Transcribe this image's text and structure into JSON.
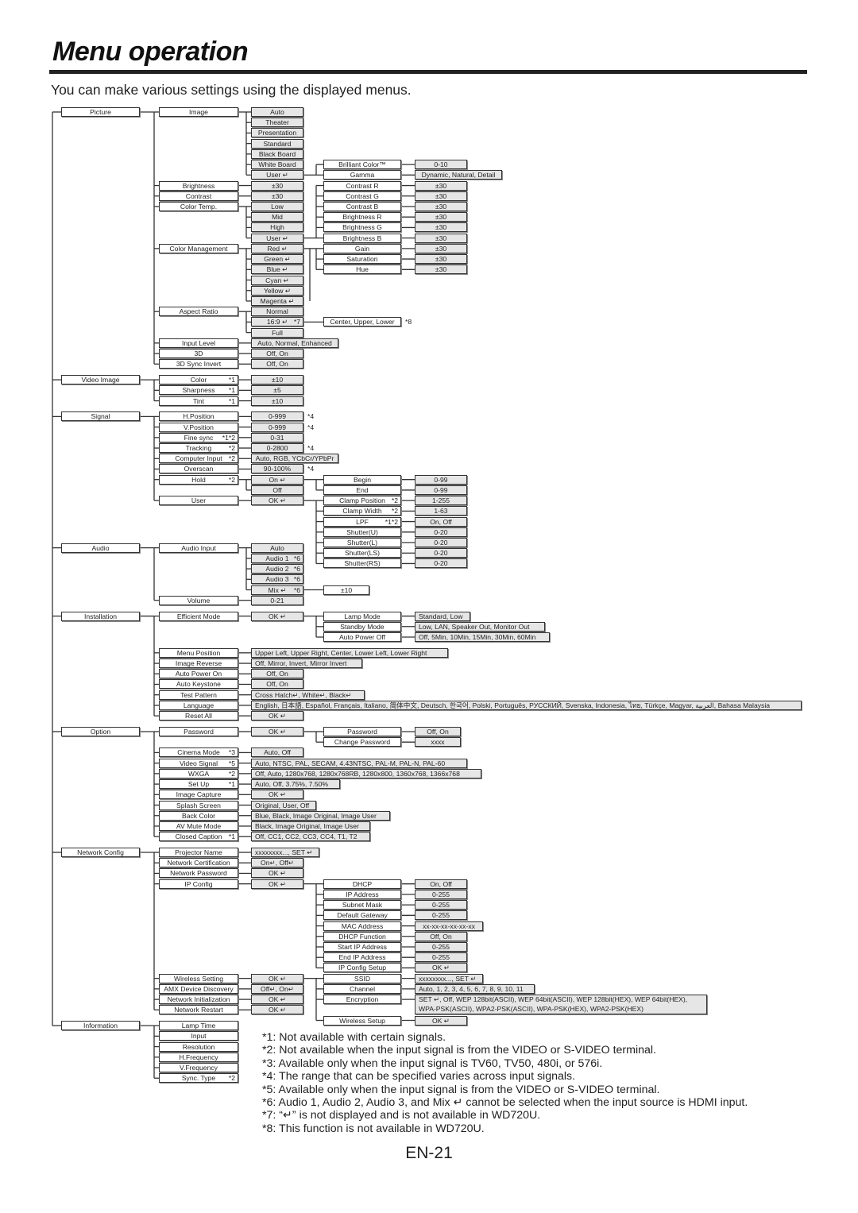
{
  "header": {
    "title": "Menu operation",
    "subtitle": "You can make various settings using the displayed menus."
  },
  "menu": {
    "top": [
      "Picture",
      "Video Image",
      "Signal",
      "Audio",
      "Installation",
      "Option",
      "Network Config",
      "Information"
    ],
    "picture": {
      "items": [
        "Image",
        "Brightness",
        "Contrast",
        "Color Temp.",
        "Color Management",
        "Aspect Ratio",
        "Input Level",
        "3D",
        "3D Sync Invert"
      ],
      "image_modes": [
        "Auto",
        "Theater",
        "Presentation",
        "Standard",
        "Black Board",
        "White Board",
        "User ↵"
      ],
      "brightness_value": "±30",
      "contrast_value": "±30",
      "color_temp": [
        "Low",
        "Mid",
        "High",
        "User ↵"
      ],
      "color_mgmt": [
        "Red ↵",
        "Green ↵",
        "Blue ↵",
        "Cyan ↵",
        "Yellow ↵",
        "Magenta ↵"
      ],
      "aspect": [
        "Normal",
        "16:9 ↵",
        "Full"
      ],
      "aspect_note": "*7",
      "input_level_value": "Auto, Normal, Enhanced",
      "d3_value": "Off, On",
      "d3_sync_value": "Off, On",
      "user_image": [
        "Brilliant Color™",
        "Gamma"
      ],
      "user_image_values": [
        "0-10",
        "Dynamic, Natural, Detail"
      ],
      "user_temp": [
        "Contrast R",
        "Contrast G",
        "Contrast B",
        "Brightness R",
        "Brightness G",
        "Brightness B"
      ],
      "user_temp_values": [
        "±30",
        "±30",
        "±30",
        "±30",
        "±30",
        "±30"
      ],
      "cm_items": [
        "Gain",
        "Saturation",
        "Hue"
      ],
      "cm_values": [
        "±30",
        "±30",
        "±30"
      ],
      "aspect_sub": "Center, Upper, Lower",
      "aspect_sub_note": "*8"
    },
    "video_image": {
      "items": [
        "Color",
        "Sharpness",
        "Tint"
      ],
      "item_notes": [
        "*1",
        "*1",
        "*1"
      ],
      "values": [
        "±10",
        "±5",
        "±10"
      ]
    },
    "signal": {
      "items": [
        "H.Position",
        "V.Position",
        "Fine sync",
        "Tracking",
        "Computer Input",
        "Overscan",
        "Hold",
        "User"
      ],
      "item_notes": [
        "",
        "",
        "*1*2",
        "*2",
        "*2",
        "",
        "*2",
        ""
      ],
      "values": [
        "0-999",
        "0-999",
        "0-31",
        "0-2800",
        "Auto, RGB, YCbCr/YPbPr",
        "90-100%"
      ],
      "value_notes": [
        "*4",
        "*4",
        "",
        "*4",
        "",
        "*4"
      ],
      "hold_values": [
        "On ↵",
        "Off"
      ],
      "user_value": "OK ↵",
      "hold_sub": [
        "Begin",
        "End"
      ],
      "hold_sub_values": [
        "0-99",
        "0-99"
      ],
      "user_sub": [
        "Clamp Position",
        "Clamp Width",
        "LPF",
        "Shutter(U)",
        "Shutter(L)",
        "Shutter(LS)",
        "Shutter(RS)"
      ],
      "user_sub_notes": [
        "*2",
        "*2",
        "*1*2",
        "",
        "",
        "",
        ""
      ],
      "user_sub_values": [
        "1-255",
        "1-63",
        "On, Off",
        "0-20",
        "0-20",
        "0-20",
        "0-20"
      ]
    },
    "audio": {
      "items": [
        "Audio Input",
        "Volume"
      ],
      "input_values": [
        "Auto",
        "Audio 1",
        "Audio 2",
        "Audio 3",
        "Mix ↵"
      ],
      "input_notes": [
        "",
        "*6",
        "*6",
        "*6",
        "*6"
      ],
      "volume_value": "0-21",
      "mix_value": "±10"
    },
    "installation": {
      "items": [
        "Efficient Mode",
        "Menu Position",
        "Image Reverse",
        "Auto Power On",
        "Auto Keystone",
        "Test Pattern",
        "Language",
        "Reset All"
      ],
      "values": [
        "OK ↵",
        "Upper Left, Upper Right, Center, Lower Left, Lower Right",
        "Off, Mirror, Invert, Mirror Invert",
        "Off, On",
        "Off, On",
        "Cross Hatch↵, White↵, Black↵",
        "English, 日本語, Español, Français, Italiano, 简体中文, Deutsch, 한국어, Polski, Português, РУССКИЙ, Svenska, Indonesia, ไทย, Türkçe, Magyar, العربية, Bahasa Malaysia",
        "OK ↵"
      ],
      "efficient_sub": [
        "Lamp Mode",
        "Standby Mode",
        "Auto Power Off"
      ],
      "efficient_sub_values": [
        "Standard, Low",
        "Low, LAN, Speaker Out, Monitor Out",
        "Off, 5Min, 10Min, 15Min, 30Min, 60Min"
      ]
    },
    "option": {
      "items": [
        "Password",
        "Cinema Mode",
        "Video Signal",
        "WXGA",
        "Set Up",
        "Image Capture",
        "Splash Screen",
        "Back Color",
        "AV Mute Mode",
        "Closed Caption"
      ],
      "item_notes": [
        "",
        "*3",
        "*5",
        "*2",
        "*1",
        "",
        "",
        "",
        "",
        "*1"
      ],
      "values": [
        "OK ↵",
        "Auto, Off",
        "Auto, NTSC, PAL, SECAM, 4.43NTSC, PAL-M, PAL-N, PAL-60",
        "Off, Auto, 1280x768, 1280x768RB, 1280x800, 1360x768, 1366x768",
        "Auto, Off, 3.75%, 7.50%",
        "OK ↵",
        "Original, User, Off",
        "Blue, Black, Image Original, Image User",
        "Black, Image Original, Image User",
        "Off, CC1, CC2, CC3, CC4, T1, T2"
      ],
      "password_sub": [
        "Password",
        "Change Password"
      ],
      "password_sub_values": [
        "Off, On",
        "xxxx"
      ]
    },
    "network": {
      "items": [
        "Projector Name",
        "Network Certification",
        "Network Password",
        "IP Config",
        "Wireless Setting",
        "AMX Device Discovery",
        "Network Initialization",
        "Network Restart"
      ],
      "values": [
        "xxxxxxxx..., SET ↵",
        "On↵, Off↵",
        "OK ↵",
        "OK ↵",
        "OK ↵",
        "Off↵, On↵",
        "OK ↵",
        "OK ↵"
      ],
      "ip_sub": [
        "DHCP",
        "IP Address",
        "Subnet Mask",
        "Default Gateway",
        "MAC Address",
        "DHCP Function",
        "Start IP Address",
        "End IP Address",
        "IP Config Setup"
      ],
      "ip_sub_values": [
        "On, Off",
        "0-255",
        "0-255",
        "0-255",
        "xx-xx-xx-xx-xx-xx",
        "Off, On",
        "0-255",
        "0-255",
        "OK ↵"
      ],
      "wireless_sub": [
        "SSID",
        "Channel",
        "Encryption",
        "Wireless Setup"
      ],
      "wireless_sub_values": [
        "xxxxxxxx..., SET ↵",
        "Auto, 1, 2, 3, 4, 5, 6, 7, 8, 9, 10, 11",
        "SET ↵, Off,  WEP 128bit(ASCII), WEP 64bit(ASCII), WEP 128bit(HEX), WEP 64bit(HEX), WPA-PSK(ASCII), WPA2-PSK(ASCII), WPA-PSK(HEX), WPA2-PSK(HEX)",
        "OK ↵"
      ]
    },
    "information": {
      "items": [
        "Lamp Time",
        "Input",
        "Resolution",
        "H.Frequency",
        "V.Frequency",
        "Sync. Type"
      ],
      "item_notes": [
        "",
        "",
        "",
        "",
        "",
        "*2"
      ]
    }
  },
  "footnotes": [
    "*1: Not available with certain signals.",
    "*2: Not available when the input signal is from the VIDEO or S-VIDEO terminal.",
    "*3: Available only when the input signal is TV60, TV50, 480i, or 576i.",
    "*4: The range that can be specified varies across input signals.",
    "*5: Available only when the input signal is from the VIDEO or S-VIDEO terminal.",
    "*6: Audio 1, Audio 2, Audio 3, and Mix ↵ cannot be selected when the input source is HDMI input.",
    "*7: “↵” is not displayed and is not available in WD720U.",
    "*8: This function is not available in WD720U."
  ],
  "page_number": "EN-21",
  "colors": {
    "box_border": "#333333",
    "value_fill": "#e6e6e6",
    "line": "#333333"
  }
}
